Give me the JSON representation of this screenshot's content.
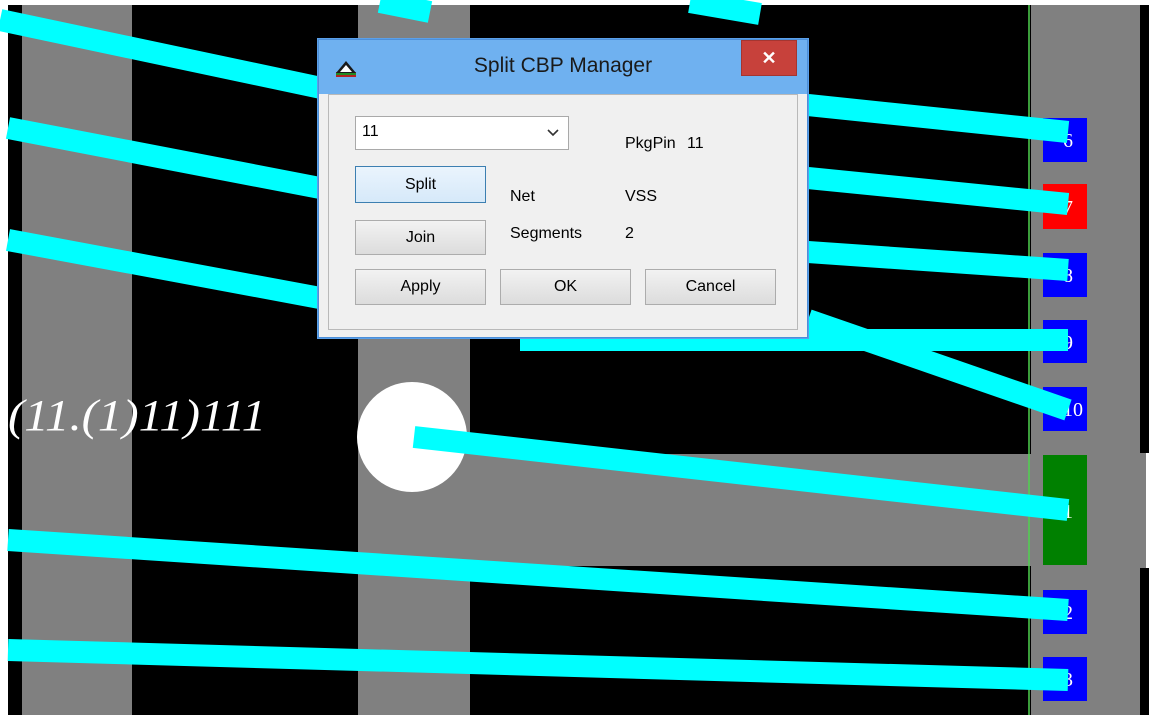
{
  "dialog": {
    "title": "Split CBP Manager",
    "close_glyph": "✕",
    "pkgpin_label": "PkgPin",
    "pkgpin_value": "11",
    "combo_value": "11",
    "net_label": "Net",
    "net_value": "VSS",
    "segments_label": "Segments",
    "segments_value": "2",
    "buttons": {
      "split": "Split",
      "join": "Join",
      "apply": "Apply",
      "ok": "OK",
      "cancel": "Cancel"
    }
  },
  "layout_view": {
    "overlap_text": "(11.(1)11)111",
    "pin_labels": [
      "6",
      "7",
      "8",
      "9",
      "10",
      "1",
      "2",
      "3"
    ],
    "colors": {
      "background": "#000000",
      "column": "#808080",
      "trace": "#00ffff",
      "pin_default": "#0000ff",
      "pin_selected": "#ff0000",
      "pin_highlight": "#008000",
      "boundary_line": "#4fd14f"
    }
  }
}
